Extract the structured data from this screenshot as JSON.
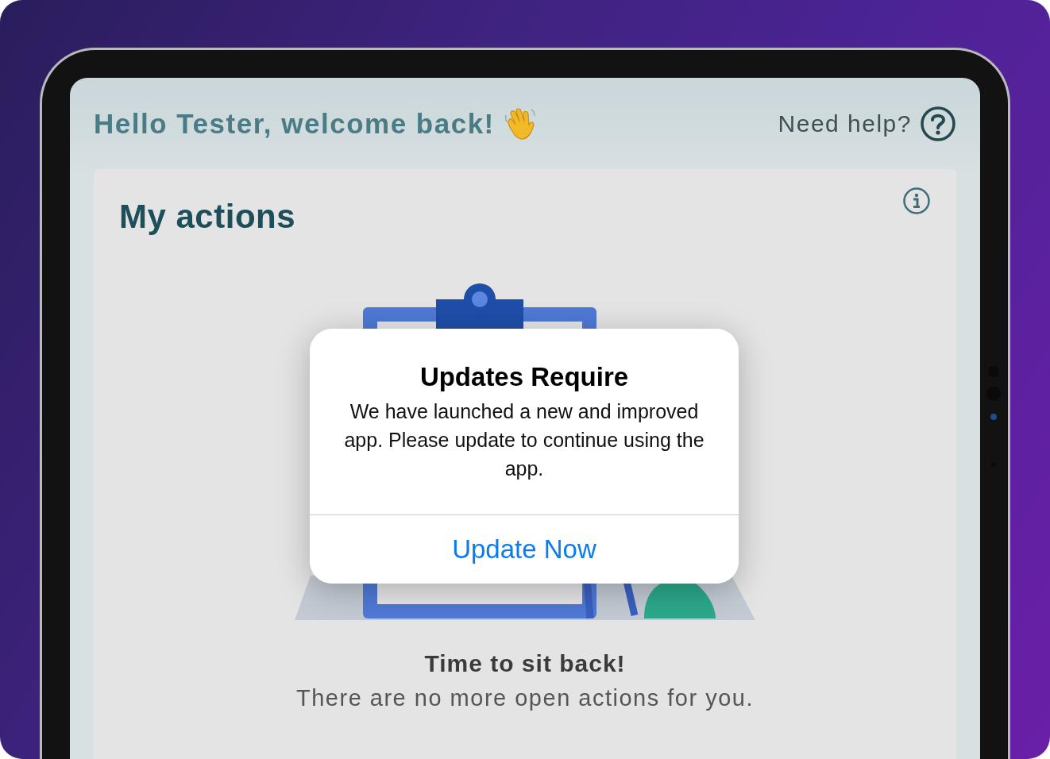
{
  "header": {
    "greeting": "Hello Tester, welcome back!",
    "help_label": "Need help?"
  },
  "card": {
    "title": "My actions",
    "empty_title": "Time to sit back!",
    "empty_message": "There are no more open actions for you."
  },
  "dialog": {
    "title": "Updates Require",
    "message": "We have launched a new and improved app. Please update to continue using the app.",
    "button": "Update Now"
  }
}
